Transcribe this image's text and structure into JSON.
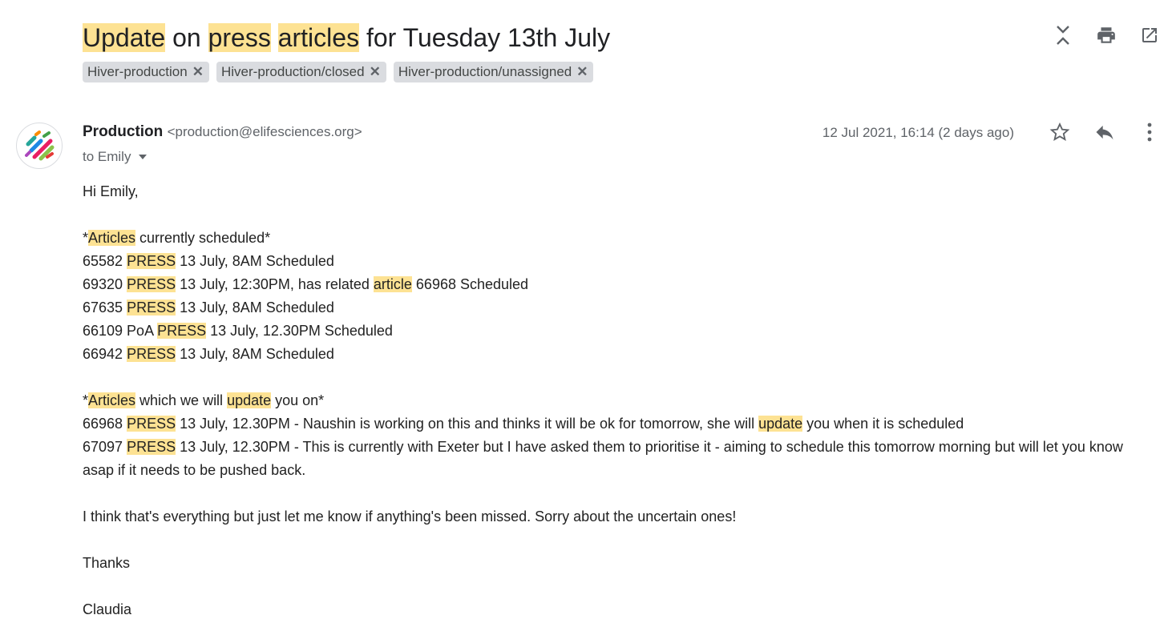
{
  "subject": {
    "w1": "Update",
    "w2": " on ",
    "w3": "press",
    "w4": " ",
    "w5": "articles",
    "w6": " for Tuesday 13th July"
  },
  "top_icons": [
    "collapse-icon",
    "print-icon",
    "open-in-new-window-icon"
  ],
  "labels": [
    {
      "text": "Hiver-production"
    },
    {
      "text": "Hiver-production/closed"
    },
    {
      "text": "Hiver-production/unassigned"
    }
  ],
  "message": {
    "sender_name": "Production",
    "sender_email": "<production@elifesciences.org>",
    "to": "to Emily",
    "date": "12 Jul 2021, 16:14 (2 days ago)"
  },
  "body": {
    "greeting": "Hi Emily,",
    "s1": {
      "a": "*",
      "b": "Articles",
      "c": " currently scheduled*"
    },
    "l1": {
      "a": "65582 ",
      "b": "PRESS",
      "c": " 13 July, 8AM Scheduled"
    },
    "l2": {
      "a": "69320 ",
      "b": "PRESS",
      "c": " 13 July, 12:30PM, has related ",
      "d": "article",
      "e": " 66968 Scheduled"
    },
    "l3": {
      "a": "67635 ",
      "b": "PRESS",
      "c": " 13 July, 8AM Scheduled"
    },
    "l4": {
      "a": "66109 PoA ",
      "b": "PRESS",
      "c": " 13 July, 12.30PM Scheduled"
    },
    "l5": {
      "a": "66942 ",
      "b": "PRESS",
      "c": " 13 July, 8AM Scheduled"
    },
    "s2": {
      "a": "*",
      "b": "Articles",
      "c": " which we will ",
      "d": "update",
      "e": " you on*"
    },
    "l6": {
      "a": "66968 ",
      "b": "PRESS",
      "c": " 13 July, 12.30PM - Naushin is working on this and thinks it will be ok for tomorrow, she will ",
      "d": "update",
      "e": " you when it is scheduled"
    },
    "l7": {
      "a": "67097 ",
      "b": "PRESS",
      "c": " 13 July, 12.30PM - This is currently with Exeter but I have asked them to prioritise it - aiming to schedule this tomorrow morning but will let you know asap if it needs to be pushed back."
    },
    "closing": "I think that's everything but just let me know if anything's been missed. Sorry about the uncertain ones!",
    "thanks": "Thanks",
    "signature": "Claudia"
  },
  "colors": {
    "highlight": "#fde293",
    "chip": "#dadce0",
    "icon": "#5f6368"
  }
}
